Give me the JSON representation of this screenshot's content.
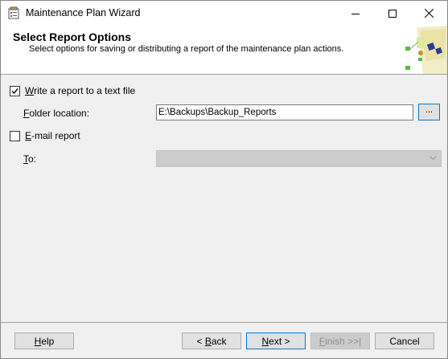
{
  "window": {
    "title": "Maintenance Plan Wizard"
  },
  "header": {
    "title": "Select Report Options",
    "subtitle": "Select options for saving or distributing a report of the maintenance plan actions."
  },
  "options": {
    "write_report": {
      "label_prefix": "W",
      "label_rest": "rite a report to a text file",
      "checked": true
    },
    "folder": {
      "label_prefix": "F",
      "label_rest": "older location:",
      "value": "E:\\Backups\\Backup_Reports",
      "browse_label": "..."
    },
    "email_report": {
      "label_prefix": "E",
      "label_rest": "-mail report",
      "checked": false
    },
    "to": {
      "label_prefix": "T",
      "label_rest": "o:",
      "value": ""
    }
  },
  "buttons": {
    "help": {
      "u": "H",
      "rest": "elp"
    },
    "back": {
      "pre": "< ",
      "u": "B",
      "rest": "ack"
    },
    "next": {
      "u": "N",
      "rest": "ext >"
    },
    "finish": {
      "u": "F",
      "rest": "inish >>|"
    },
    "cancel": {
      "label": "Cancel"
    }
  },
  "colors": {
    "accent": "#0078d7",
    "header_bg": "#ffffff",
    "dialog_bg": "#f0f0f0"
  },
  "icons": [
    "app-icon",
    "minimize-icon",
    "maximize-icon",
    "close-icon",
    "checkmark-icon",
    "chevron-down-icon",
    "wizard-banner-art"
  ]
}
